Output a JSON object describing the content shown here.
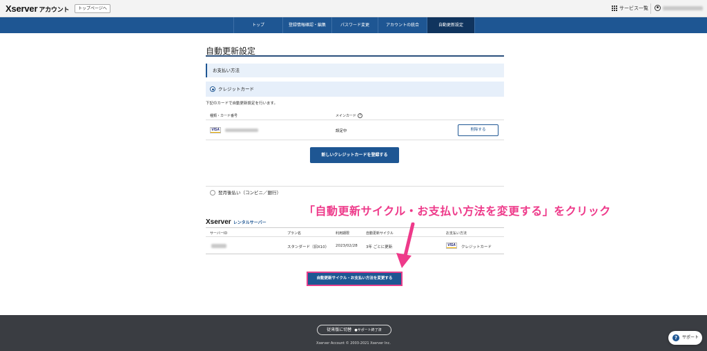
{
  "header": {
    "logo_main": "Xserver",
    "logo_sub": "アカウント",
    "toppage_label": "トップページへ",
    "services_label": "サービス一覧"
  },
  "nav": {
    "items": [
      {
        "label": "トップ"
      },
      {
        "label": "登録情報確認・編集"
      },
      {
        "label": "パスワード変更"
      },
      {
        "label": "アカウントの統合"
      },
      {
        "label": "自動更新設定"
      }
    ],
    "active": "自動更新設定"
  },
  "page": {
    "title": "自動更新設定",
    "section_title": "お支払い方法",
    "credit_option": "クレジットカード",
    "description": "下記のカードで自動更新設定を行います。",
    "card_table": {
      "col_type": "種類・カード番号",
      "col_main": "メインカード",
      "help_icon": "?",
      "row": {
        "brand": "VISA",
        "status": "設定中",
        "delete_label": "削除する"
      }
    },
    "register_button": "新しいクレジットカードを登録する",
    "convenience_option": "翌月後払い（コンビニ／銀行）"
  },
  "server": {
    "logo_main": "Xserver",
    "logo_sub": "レンタルサーバー",
    "headers": {
      "server_id": "サーバーID",
      "plan": "プラン名",
      "expiry": "利用期限",
      "cycle": "自動更新サイクル",
      "payment": "お支払い方法"
    },
    "row": {
      "plan": "スタンダード（旧X10）",
      "expiry": "2023/02/28",
      "cycle": "3年 ごとに更新",
      "payment_brand": "VISA",
      "payment": "クレジットカード"
    },
    "change_button": "自動更新サイクル・お支払い方法を変更する"
  },
  "annotation": {
    "text": "「自動更新サイクル・お支払い方法を変更する」をクリック",
    "color": "#ee3a8a"
  },
  "footer": {
    "classic_label": "従来版に切替",
    "classic_note": "●サポート終了済",
    "copyright": "Xserver Account © 2003-2021 Xserver Inc.",
    "support_label": "サポート",
    "support_icon": "?"
  },
  "colors": {
    "brand_blue": "#1e5693",
    "nav_active": "#10345e",
    "footer_bg": "#3a3d42",
    "highlight": "#e83e8c"
  }
}
